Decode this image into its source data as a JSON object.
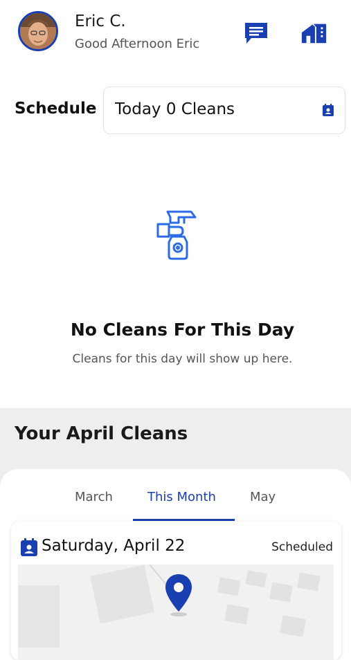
{
  "header": {
    "user_name": "Eric C.",
    "greeting": "Good Afternoon Eric",
    "icons": [
      "chat-icon",
      "properties-icon"
    ]
  },
  "schedule": {
    "label": "Schedule",
    "selected": "Today 0 Cleans"
  },
  "empty_state": {
    "title": "No Cleans For This Day",
    "subtitle": "Cleans for this day will show up here."
  },
  "month_section": {
    "title": "Your April Cleans",
    "tabs": [
      {
        "label": "March",
        "active": false
      },
      {
        "label": "This Month",
        "active": true
      },
      {
        "label": "May",
        "active": false
      }
    ]
  },
  "cleans": [
    {
      "date": "Saturday, April 22",
      "status": "Scheduled"
    }
  ],
  "colors": {
    "accent": "#1a3fb0",
    "section_bg": "#eeeeee"
  }
}
